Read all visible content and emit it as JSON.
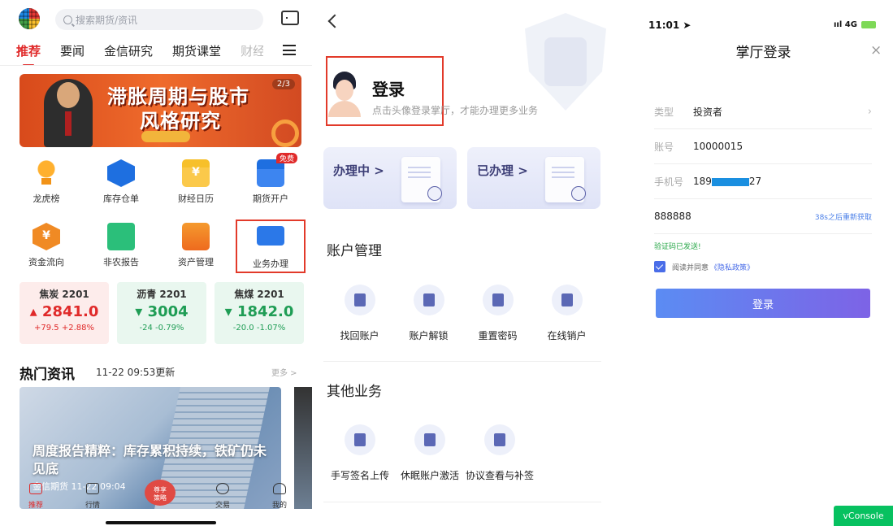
{
  "panel1": {
    "search_placeholder": "搜索期货/资讯",
    "tabs": [
      "推荐",
      "要闻",
      "金信研究",
      "期货课堂",
      "财经"
    ],
    "banner": {
      "line1": "滞胀周期与股市",
      "line2": "风格研究",
      "page": "2/3"
    },
    "grid_row1": [
      {
        "label": "龙虎榜",
        "icon": "trophy-icon"
      },
      {
        "label": "库存仓单",
        "icon": "cube-icon"
      },
      {
        "label": "财经日历",
        "icon": "calendar-icon"
      },
      {
        "label": "期货开户",
        "icon": "card-icon",
        "badge": "免费"
      }
    ],
    "grid_row2": [
      {
        "label": "资金流向",
        "icon": "yuan-icon"
      },
      {
        "label": "非农报告",
        "icon": "report-icon"
      },
      {
        "label": "资产管理",
        "icon": "folder-icon"
      },
      {
        "label": "业务办理",
        "icon": "monitor-icon"
      }
    ],
    "quotes": [
      {
        "name": "焦炭 2201",
        "price": "2841.0",
        "change": "+79.5 +2.88%",
        "arrow": "▴",
        "trend": "up"
      },
      {
        "name": "沥青 2201",
        "price": "3004",
        "change": "-24 -0.79%",
        "arrow": "▾",
        "trend": "down"
      },
      {
        "name": "焦煤 2201",
        "price": "1842.0",
        "change": "-20.0 -1.07%",
        "arrow": "▾",
        "trend": "down"
      }
    ],
    "news": {
      "heading": "热门资讯",
      "updated": "11-22 09:53更新",
      "more": "更多 >",
      "headline": "周度报告精粹：库存累积持续，铁矿仍未见底",
      "source": "金信期货  11-22 09:04"
    },
    "floating": {
      "line1": "尊享",
      "line2": "策略"
    },
    "bottom_nav": [
      "推荐",
      "行情",
      "交易",
      "我的"
    ]
  },
  "panel2": {
    "login_title": "登录",
    "login_sub": "点击头像登录掌厅，才能办理更多业务",
    "card_doing": "办理中 >",
    "card_done": "已办理 >",
    "section_account": "账户管理",
    "account_items": [
      "找回账户",
      "账户解锁",
      "重置密码",
      "在线销户"
    ],
    "section_other": "其他业务",
    "other_items": [
      "手写签名上传",
      "休眠账户激活",
      "协议查看与补签"
    ]
  },
  "panel3": {
    "time": "11:01",
    "signal": "4G",
    "title": "掌厅登录",
    "close": "×",
    "type_label": "类型",
    "type_value": "投资者",
    "account_label": "账号",
    "account_value": "10000015",
    "phone_label": "手机号",
    "phone_prefix": "189",
    "phone_suffix": "27",
    "code_value": "888888",
    "resend": "38s之后重新获取",
    "sms_sent": "验证码已发送!",
    "agree_text": "阅读并同意",
    "policy": "《隐私政策》",
    "login_button": "登录",
    "vconsole": "vConsole"
  }
}
